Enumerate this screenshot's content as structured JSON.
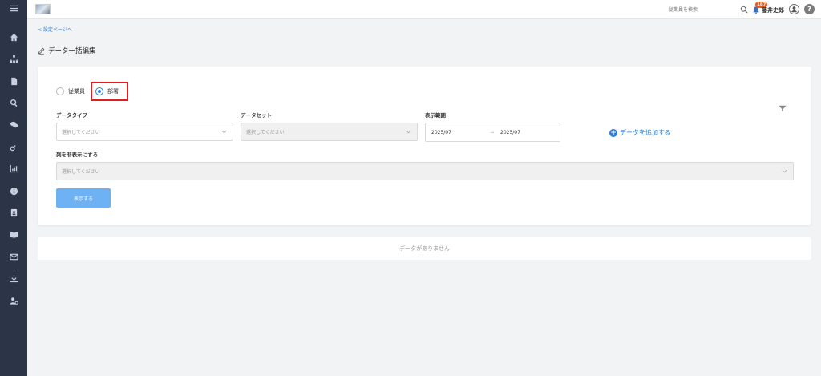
{
  "header": {
    "search_placeholder": "従業員を検索",
    "notification_count": "187",
    "username": "藤井史郎",
    "help_label": "?"
  },
  "breadcrumb": "< 設定ページへ",
  "page_title": "データ一括編集",
  "form": {
    "radio_employee": "従業員",
    "radio_department": "部署",
    "selected_radio": "部署",
    "data_type_label": "データタイプ",
    "data_type_placeholder": "選択してください",
    "dataset_label": "データセット",
    "dataset_placeholder": "選択してください",
    "display_range_label": "表示範囲",
    "range_start": "2025/07",
    "range_arrow": "→",
    "range_end": "2025/07",
    "add_data_label": "データを追加する",
    "hide_columns_label": "列を非表示にする",
    "hide_columns_placeholder": "選択してください",
    "show_button": "表示する"
  },
  "empty_message": "データがありません",
  "colors": {
    "sidebar": "#2c3447",
    "accent": "#2f7fd3",
    "button": "#6fb2f3",
    "highlight": "#e11d1d",
    "badge": "#e8571b"
  },
  "sidebar_icons": [
    "menu-icon",
    "home-icon",
    "org-chart-icon",
    "document-icon",
    "search-icon",
    "chat-icon",
    "key-icon",
    "chart-icon",
    "info-icon",
    "contacts-icon",
    "book-icon",
    "mail-icon",
    "download-icon",
    "user-settings-icon"
  ]
}
